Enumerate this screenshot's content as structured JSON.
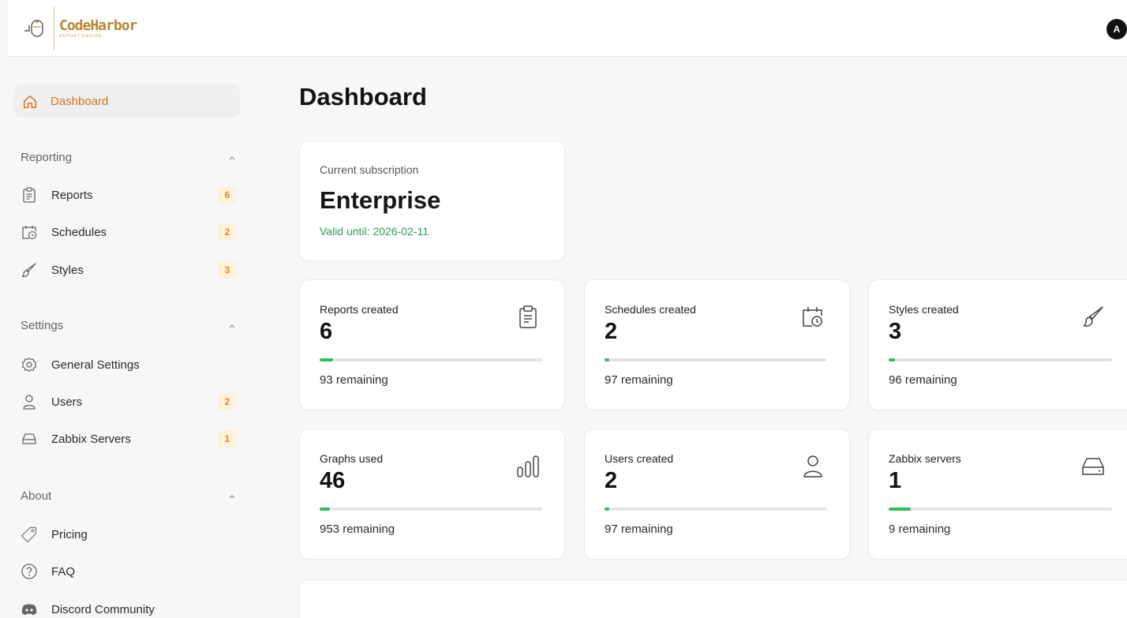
{
  "brand": {
    "name": "CodeHarbor",
    "tagline": "REPORT ENGINE"
  },
  "user": {
    "initial": "A"
  },
  "sidebar": {
    "dashboard": {
      "label": "Dashboard",
      "icon": "home-icon"
    },
    "sections": [
      {
        "title": "Reporting",
        "items": [
          {
            "label": "Reports",
            "icon": "clipboard-icon",
            "badge": "6"
          },
          {
            "label": "Schedules",
            "icon": "calendar-clock-icon",
            "badge": "2"
          },
          {
            "label": "Styles",
            "icon": "brush-icon",
            "badge": "3"
          }
        ]
      },
      {
        "title": "Settings",
        "items": [
          {
            "label": "General Settings",
            "icon": "gear-icon",
            "badge": ""
          },
          {
            "label": "Users",
            "icon": "user-icon",
            "badge": "2"
          },
          {
            "label": "Zabbix Servers",
            "icon": "server-drive-icon",
            "badge": "1"
          }
        ]
      },
      {
        "title": "About",
        "items": [
          {
            "label": "Pricing",
            "icon": "tag-icon",
            "badge": ""
          },
          {
            "label": "FAQ",
            "icon": "question-circle-icon",
            "badge": ""
          },
          {
            "label": "Discord Community",
            "icon": "discord-icon",
            "badge": ""
          }
        ]
      }
    ]
  },
  "main": {
    "title": "Dashboard",
    "subscription": {
      "label": "Current subscription",
      "plan": "Enterprise",
      "valid": "Valid until: 2026-02-11"
    },
    "stats": [
      {
        "title": "Reports created",
        "value": "6",
        "remaining": "93 remaining",
        "usage": 0.06,
        "icon": "clipboard-icon"
      },
      {
        "title": "Schedules created",
        "value": "2",
        "remaining": "97 remaining",
        "usage": 0.02,
        "icon": "calendar-clock-icon"
      },
      {
        "title": "Styles created",
        "value": "3",
        "remaining": "96 remaining",
        "usage": 0.03,
        "icon": "brush-icon"
      },
      {
        "title": "Graphs used",
        "value": "46",
        "remaining": "953 remaining",
        "usage": 0.046,
        "icon": "bar-chart-icon"
      },
      {
        "title": "Users created",
        "value": "2",
        "remaining": "97 remaining",
        "usage": 0.02,
        "icon": "user-icon"
      },
      {
        "title": "Zabbix servers",
        "value": "1",
        "remaining": "9 remaining",
        "usage": 0.1,
        "icon": "server-drive-icon"
      }
    ]
  },
  "colors": {
    "accent": "#d4761f",
    "success": "#2bbf5a",
    "badge_bg": "#fdf1dc",
    "badge_text": "#e08a1e"
  }
}
